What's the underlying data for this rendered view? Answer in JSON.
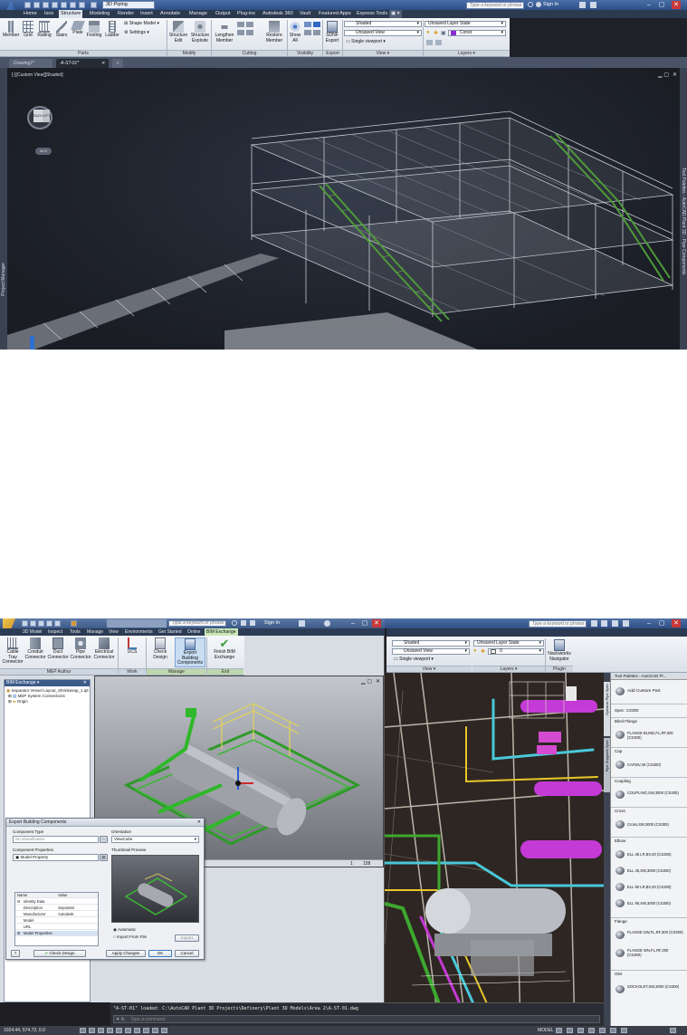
{
  "top": {
    "workspace": "3D Piping",
    "search_placeholder": "Type a keyword or phrase",
    "sign_in": "Sign In",
    "ribbon_tabs": [
      "Home",
      "Isos",
      "Structure",
      "Modeling",
      "Render",
      "Insert",
      "Annotate",
      "Manage",
      "Output",
      "Plug-ins",
      "Autodesk 360",
      "Vault",
      "Featured Apps",
      "Express Tools"
    ],
    "active_tab_index": 2,
    "parts_buttons": [
      "Member",
      "Grid",
      "Railing",
      "Stairs",
      "Plate",
      "Footing",
      "Ladder"
    ],
    "shape_model": "Shape Model",
    "settings": "Settings",
    "modify_buttons": [
      "Structure Edit",
      "Structure Explode"
    ],
    "cutting_buttons": [
      "Lengthen Member",
      "Restore Member"
    ],
    "visibility_button": "Show All",
    "export_button": "SDNF Export",
    "view_combos": [
      "Shaded",
      "Unsaved View",
      "Single viewport"
    ],
    "layer_combos": [
      "Unsaved Layer State",
      "Const"
    ],
    "panels": [
      "Parts",
      "Modify",
      "Cutting",
      "Visibility",
      "Export",
      "View",
      "Layers"
    ],
    "doc_tabs": [
      "Drawing1*",
      "A-ST-01*"
    ],
    "viewport_label": "[-][Custom View][Shaded]",
    "viewcube_labels": [
      "BACK",
      "LEFT"
    ],
    "viewcube_compass": "WCS",
    "left_strip": "Project Manager",
    "right_strip": "Tool Palettes - AutoCAD Plant 3D - Pipe Components"
  },
  "bottom": {
    "revit": {
      "search_placeholder": "Type a keyword or phrase",
      "sign_in": "Sign In",
      "tabs": [
        "3D Model",
        "Inspect",
        "Tools",
        "Manage",
        "View",
        "Environments",
        "Get Started",
        "Online",
        "BIM Exchange"
      ],
      "active_tab_index": 8,
      "mep_buttons": [
        "Cable Tray Connector",
        "Conduit Connector",
        "Duct Connector",
        "Pipe Connector",
        "Electrical Connector"
      ],
      "work_feature_button": "UCS",
      "manage_buttons": [
        "Check Design",
        "Export Building Components"
      ],
      "exit_button": "Finish BIM Exchange",
      "panels": [
        "MEP Authur",
        "Work Feature",
        "Manage",
        "Exit"
      ],
      "tree_title": "BIM Exchange",
      "tree_items": [
        "Separator Vessel Layout_Shrinkwrap_1.ipt",
        "MEP System Connections",
        "Origin"
      ],
      "view_footer": [
        "1",
        "158"
      ]
    },
    "dialog": {
      "title": "Export Building Components",
      "component_type_label": "Component Type",
      "component_type_placeholder": "No classification",
      "component_props_label": "Component Properties",
      "model_property": "Model Property",
      "prop_headers": [
        "Name",
        "Value"
      ],
      "props": [
        {
          "name": "Identity Data",
          "value": ""
        },
        {
          "name": "Description",
          "value": "Separator"
        },
        {
          "name": "Manufacturer",
          "value": "Autodesk"
        },
        {
          "name": "Model",
          "value": ""
        },
        {
          "name": "URL",
          "value": ""
        },
        {
          "name": "Model Properties",
          "value": ""
        }
      ],
      "orientation_label": "Orientation",
      "orientation_value": "ViewCube",
      "thumbnail_label": "Thumbnail Preview",
      "radio_auto": "Automatic",
      "radio_import": "Import From File",
      "import_button": "Import",
      "check_design_button": "Check Design",
      "apply_button": "Apply Changes",
      "ok_button": "OK",
      "cancel_button": "Cancel"
    },
    "acad": {
      "search_placeholder": "Type a keyword or phrase",
      "view_combos": [
        "Shaded",
        "Unsaved View",
        "Single viewport"
      ],
      "layer_combos": [
        "Unsaved Layer State",
        "0"
      ],
      "panels": [
        "View",
        "Layers",
        "Plugin"
      ],
      "navisworks_button": "Navisworks Navigator",
      "command_history": "\"A-ST-01\" loaded: C:\\AutoCAD Plant 3D Projects\\Refinery\\Plant 3D Models\\Area 2\\A-ST-01.dwg",
      "command_prompt": "Type a command",
      "coords": "1024.44, 574.72, 0.0",
      "model_label": "MODEL"
    },
    "palette": {
      "title": "Tool Palettes - AutoCAD Pl...",
      "add_custom": "Add Custom Part",
      "spec": "Spec: CS300",
      "categories": [
        {
          "name": "Blind Flange",
          "items": [
            "FLANGE BLIND,FL,RF,300 (CS300)"
          ]
        },
        {
          "name": "Cap",
          "items": [
            "CAP,BV,40 (CS300)"
          ]
        },
        {
          "name": "Coupling",
          "items": [
            "COUPLING,SW,3000 (CS300)"
          ]
        },
        {
          "name": "Cross",
          "items": [
            "Cross,SW,3000 (CS300)"
          ]
        },
        {
          "name": "Elbow",
          "items": [
            "ELL 45 LR,BV,40 (CS300)",
            "ELL 45,SW,3000 (CS300)",
            "ELL 90 LR,BV,40 (CS300)",
            "ELL 90,SW,3000 (CS300)"
          ]
        },
        {
          "name": "Flange",
          "items": [
            "FLANGE SW,FL,RF,300 (CS300)",
            "FLANGE WN,FL,RF,300 (CS300)"
          ]
        },
        {
          "name": "Olet",
          "items": [
            "SOCKOLET,SW,3000 (CS300)"
          ]
        }
      ],
      "side_tabs": [
        "Dynamic Pipe Spec",
        "Pipe Supports Spec"
      ]
    }
  },
  "colors": {
    "titlebar": "#3a5d95",
    "structure_steel": "#c9ccd2",
    "stairs_green": "#4f9a3a",
    "pipe_magenta": "#c43ad6",
    "pipe_cyan": "#48c8d8",
    "pipe_green": "#3da82f",
    "pipe_yellow": "#e8c82a"
  }
}
